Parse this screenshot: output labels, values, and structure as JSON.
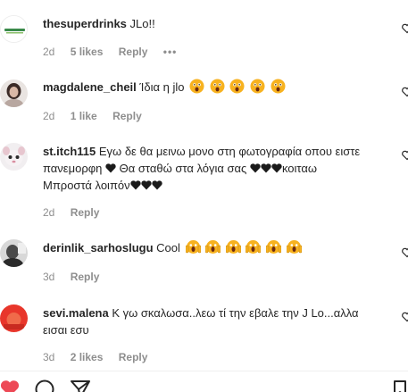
{
  "comments": [
    {
      "username": "thesuperdrinks",
      "text": "JLo!!",
      "time": "2d",
      "likes": "5 likes",
      "reply": "Reply",
      "more": "•••",
      "avatar_icon": "brand-logo-avatar"
    },
    {
      "username": "magdalene_cheil",
      "text": "Ίδια η jlo",
      "time": "2d",
      "likes": "1 like",
      "reply": "Reply",
      "emoji": "astonished-face x5",
      "avatar_icon": "person-avatar"
    },
    {
      "username": "st.itch115",
      "text_line1": "Εγω δε θα μεινω μονο στη φωτογραφία οπου ειστε",
      "text_line2a": "πανεμορφη",
      "text_line2b": "Θα σταθώ στα λόγια σας",
      "text_line2c": "κοιταω",
      "text_line3": "Μπροστά λοιπόν",
      "time": "2d",
      "reply": "Reply",
      "avatar_icon": "stitch-avatar"
    },
    {
      "username": "derinlik_sarhoslugu",
      "text": "Cool",
      "time": "3d",
      "reply": "Reply",
      "emoji": "screaming-face x6",
      "avatar_icon": "bw-portrait-avatar"
    },
    {
      "username": "sevi.malena",
      "text_line1": "Κ γω σκαλωσα..λεω τί την εβαλε την J Lo...αλλα",
      "text_line2": "εισαι εσυ",
      "time": "3d",
      "likes": "2 likes",
      "reply": "Reply",
      "avatar_icon": "red-avatar"
    }
  ],
  "actions": [
    "heart-icon",
    "comment-icon",
    "share-icon",
    "bookmark-icon"
  ],
  "colors": {
    "text": "#262626",
    "muted": "#8e8e8e",
    "like_red": "#ed4956"
  }
}
